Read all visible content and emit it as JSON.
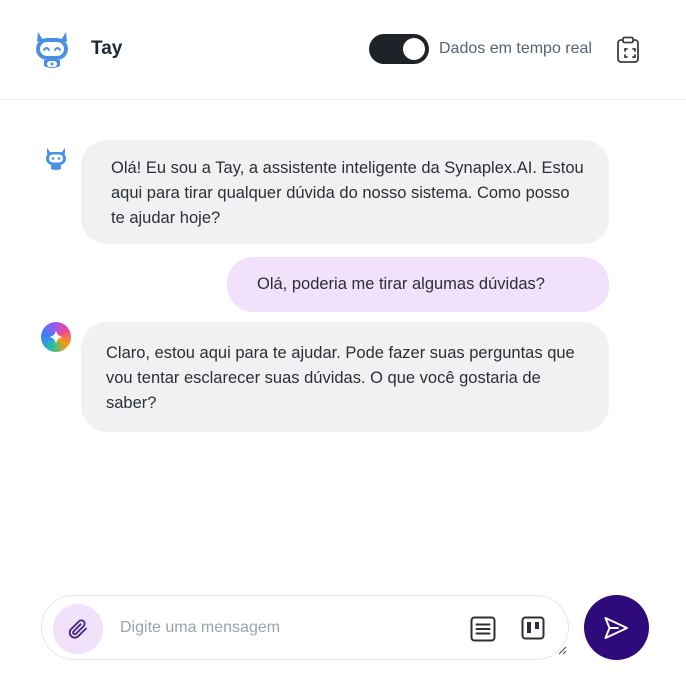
{
  "header": {
    "title": "Tay",
    "toggle_label": "Dados em tempo real",
    "toggle_on": true,
    "icons": [
      "robot-logo-icon",
      "clipboard-icon"
    ]
  },
  "messages": [
    {
      "role": "bot",
      "avatar": "robot-avatar-icon",
      "text": "Olá! Eu sou a Tay, a assistente inteligente da Synaplex.AI. Estou aqui para tirar qualquer dúvida do nosso sistema. Como posso te ajudar hoje?"
    },
    {
      "role": "user",
      "text": "Olá, poderia me tirar algumas dúvidas?"
    },
    {
      "role": "bot",
      "avatar": "ai-sparkle-avatar-icon",
      "text": "Claro, estou aqui para te ajudar. Pode fazer suas perguntas que vou tentar esclarecer suas dúvidas. O que você gostaria de saber?"
    }
  ],
  "composer": {
    "placeholder": "Digite uma mensagem",
    "value": "",
    "icons": [
      "paperclip-icon",
      "list-icon",
      "kanban-icon",
      "send-icon"
    ]
  },
  "colors": {
    "bot_bubble": "#f1f1f3",
    "user_bubble": "#f1e1fb",
    "send_button": "#2e0a7a",
    "toggle_track": "#1f2329",
    "accent_blue": "#3b82f6"
  }
}
